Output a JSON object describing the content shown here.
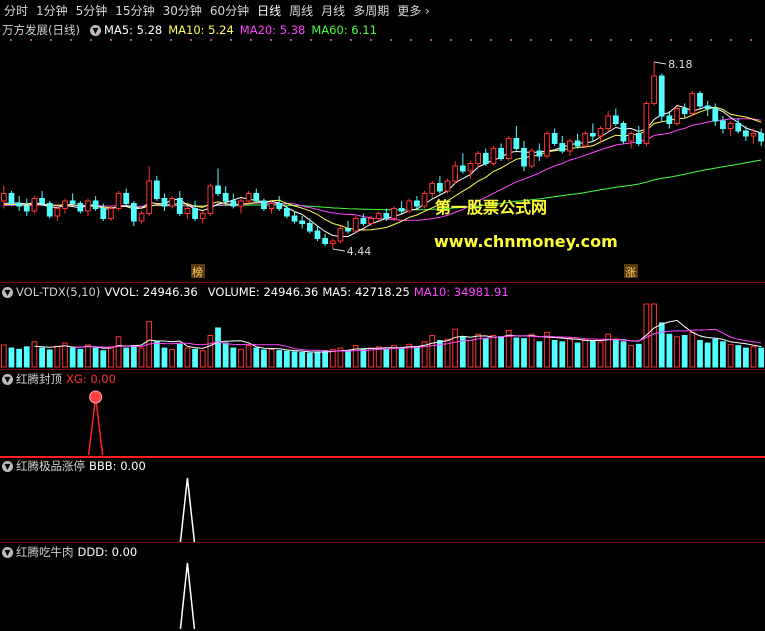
{
  "toolbar": {
    "tabs": [
      "分时",
      "1分钟",
      "5分钟",
      "15分钟",
      "30分钟",
      "60分钟",
      "日线",
      "周线",
      "月线",
      "多周期"
    ],
    "more": "更多",
    "active": "日线"
  },
  "main_panel": {
    "title": "万方发展(日线)",
    "ma": [
      {
        "label": "MA5: 5.28",
        "color": "#ffffff"
      },
      {
        "label": "MA10: 5.24",
        "color": "#ffff55"
      },
      {
        "label": "MA20: 5.38",
        "color": "#ff44ff"
      },
      {
        "label": "MA60: 6.11",
        "color": "#44ff44"
      }
    ],
    "high_label": "8.18",
    "low_label": "4.44",
    "watermark_title": "第一股票公式网",
    "watermark_url": "www.chnmoney.com",
    "tag_left": "榜",
    "tag_right": "涨"
  },
  "vol_panel": {
    "title": "VOL-TDX(5,10)",
    "vvol": "VVOL: 24946.36",
    "volume": "VOLUME: 24946.36",
    "ma5": "MA5: 42718.25",
    "ma10": "MA10: 34981.91"
  },
  "ind1": {
    "name": "红腾封顶",
    "value": "XG: 0.00"
  },
  "ind2": {
    "name": "红腾极品涨停",
    "value": "BBB: 0.00"
  },
  "ind3": {
    "name": "红腾吃牛肉",
    "value": "DDD: 0.00"
  },
  "colors": {
    "up": "#ff3232",
    "down": "#54ffff",
    "ma5": "#ffffff",
    "ma10": "#ffff55",
    "ma20": "#ff44ff",
    "ma60": "#44ff44",
    "sep": "#7a0e0e"
  },
  "chart_data": {
    "type": "candlestick",
    "ylim": [
      4.2,
      8.5
    ],
    "days": 100,
    "ohlc": [
      [
        5.4,
        5.7,
        5.25,
        5.55
      ],
      [
        5.55,
        5.6,
        5.3,
        5.35
      ],
      [
        5.35,
        5.5,
        5.2,
        5.3
      ],
      [
        5.3,
        5.45,
        5.1,
        5.2
      ],
      [
        5.2,
        5.5,
        5.15,
        5.45
      ],
      [
        5.45,
        5.6,
        5.3,
        5.35
      ],
      [
        5.35,
        5.4,
        5.05,
        5.1
      ],
      [
        5.1,
        5.3,
        5.0,
        5.25
      ],
      [
        5.25,
        5.45,
        5.15,
        5.4
      ],
      [
        5.4,
        5.55,
        5.3,
        5.35
      ],
      [
        5.35,
        5.4,
        5.15,
        5.2
      ],
      [
        5.2,
        5.45,
        5.1,
        5.4
      ],
      [
        5.4,
        5.5,
        5.2,
        5.25
      ],
      [
        5.25,
        5.35,
        5.0,
        5.05
      ],
      [
        5.05,
        5.3,
        5.0,
        5.25
      ],
      [
        5.25,
        5.6,
        5.2,
        5.55
      ],
      [
        5.55,
        5.65,
        5.3,
        5.35
      ],
      [
        5.35,
        5.4,
        4.9,
        5.0
      ],
      [
        5.0,
        5.2,
        4.95,
        5.15
      ],
      [
        5.15,
        6.1,
        5.1,
        5.8
      ],
      [
        5.8,
        5.9,
        5.4,
        5.45
      ],
      [
        5.45,
        5.55,
        5.2,
        5.3
      ],
      [
        5.3,
        5.5,
        5.25,
        5.45
      ],
      [
        5.45,
        5.6,
        5.1,
        5.15
      ],
      [
        5.15,
        5.3,
        5.05,
        5.25
      ],
      [
        5.25,
        5.4,
        5.0,
        5.05
      ],
      [
        5.05,
        5.2,
        4.95,
        5.15
      ],
      [
        5.15,
        5.75,
        5.1,
        5.7
      ],
      [
        5.7,
        6.05,
        5.5,
        5.55
      ],
      [
        5.55,
        5.7,
        5.3,
        5.4
      ],
      [
        5.4,
        5.55,
        5.25,
        5.3
      ],
      [
        5.3,
        5.45,
        5.15,
        5.4
      ],
      [
        5.4,
        5.6,
        5.35,
        5.55
      ],
      [
        5.55,
        5.65,
        5.35,
        5.4
      ],
      [
        5.4,
        5.45,
        5.2,
        5.25
      ],
      [
        5.25,
        5.4,
        5.15,
        5.35
      ],
      [
        5.35,
        5.5,
        5.2,
        5.25
      ],
      [
        5.25,
        5.3,
        5.05,
        5.1
      ],
      [
        5.1,
        5.2,
        4.95,
        5.0
      ],
      [
        5.0,
        5.1,
        4.85,
        4.95
      ],
      [
        4.95,
        5.05,
        4.75,
        4.8
      ],
      [
        4.8,
        4.9,
        4.6,
        4.65
      ],
      [
        4.65,
        4.75,
        4.5,
        4.55
      ],
      [
        4.55,
        4.65,
        4.44,
        4.6
      ],
      [
        4.6,
        4.9,
        4.55,
        4.85
      ],
      [
        4.85,
        5.0,
        4.75,
        4.8
      ],
      [
        4.8,
        5.1,
        4.75,
        5.05
      ],
      [
        5.05,
        5.15,
        4.9,
        4.95
      ],
      [
        4.95,
        5.1,
        4.9,
        5.05
      ],
      [
        5.05,
        5.2,
        5.0,
        5.15
      ],
      [
        5.15,
        5.25,
        5.0,
        5.05
      ],
      [
        5.05,
        5.3,
        5.0,
        5.25
      ],
      [
        5.25,
        5.4,
        5.15,
        5.2
      ],
      [
        5.2,
        5.45,
        5.15,
        5.4
      ],
      [
        5.4,
        5.5,
        5.25,
        5.3
      ],
      [
        5.3,
        5.6,
        5.25,
        5.55
      ],
      [
        5.55,
        5.8,
        5.45,
        5.75
      ],
      [
        5.75,
        5.9,
        5.55,
        5.6
      ],
      [
        5.6,
        5.85,
        5.55,
        5.8
      ],
      [
        5.8,
        6.2,
        5.75,
        6.1
      ],
      [
        6.1,
        6.35,
        5.95,
        6.0
      ],
      [
        6.0,
        6.2,
        5.85,
        6.15
      ],
      [
        6.15,
        6.4,
        6.05,
        6.35
      ],
      [
        6.35,
        6.45,
        6.1,
        6.15
      ],
      [
        6.15,
        6.5,
        6.1,
        6.45
      ],
      [
        6.45,
        6.55,
        6.2,
        6.25
      ],
      [
        6.25,
        6.7,
        6.2,
        6.65
      ],
      [
        6.65,
        6.9,
        6.4,
        6.45
      ],
      [
        6.45,
        6.6,
        6.0,
        6.1
      ],
      [
        6.1,
        6.45,
        6.05,
        6.4
      ],
      [
        6.4,
        6.55,
        6.2,
        6.3
      ],
      [
        6.3,
        6.8,
        6.25,
        6.75
      ],
      [
        6.75,
        6.85,
        6.5,
        6.55
      ],
      [
        6.55,
        6.7,
        6.35,
        6.4
      ],
      [
        6.4,
        6.65,
        6.3,
        6.6
      ],
      [
        6.6,
        6.75,
        6.45,
        6.5
      ],
      [
        6.5,
        6.8,
        6.45,
        6.75
      ],
      [
        6.75,
        6.95,
        6.6,
        6.7
      ],
      [
        6.7,
        6.9,
        6.55,
        6.85
      ],
      [
        6.85,
        7.2,
        6.8,
        7.1
      ],
      [
        7.1,
        7.25,
        6.9,
        6.95
      ],
      [
        6.95,
        7.0,
        6.55,
        6.6
      ],
      [
        6.6,
        6.8,
        6.45,
        6.75
      ],
      [
        6.75,
        6.9,
        6.5,
        6.55
      ],
      [
        6.55,
        7.4,
        6.5,
        7.35
      ],
      [
        7.35,
        8.18,
        7.3,
        7.9
      ],
      [
        7.9,
        7.95,
        7.0,
        7.1
      ],
      [
        7.1,
        7.2,
        6.85,
        6.95
      ],
      [
        6.95,
        7.3,
        6.9,
        7.25
      ],
      [
        7.25,
        7.35,
        7.05,
        7.15
      ],
      [
        7.15,
        7.6,
        7.1,
        7.55
      ],
      [
        7.55,
        7.6,
        7.25,
        7.3
      ],
      [
        7.3,
        7.4,
        7.1,
        7.25
      ],
      [
        7.25,
        7.35,
        6.9,
        7.0
      ],
      [
        7.0,
        7.1,
        6.75,
        6.85
      ],
      [
        6.85,
        7.0,
        6.7,
        6.95
      ],
      [
        6.95,
        7.05,
        6.75,
        6.8
      ],
      [
        6.8,
        6.9,
        6.6,
        6.7
      ],
      [
        6.7,
        6.85,
        6.55,
        6.75
      ],
      [
        6.75,
        6.85,
        6.5,
        6.6
      ]
    ],
    "volume": [
      0.35,
      0.3,
      0.28,
      0.32,
      0.4,
      0.3,
      0.27,
      0.33,
      0.38,
      0.3,
      0.28,
      0.35,
      0.3,
      0.26,
      0.32,
      0.48,
      0.3,
      0.34,
      0.3,
      0.72,
      0.4,
      0.3,
      0.28,
      0.36,
      0.3,
      0.28,
      0.26,
      0.5,
      0.62,
      0.38,
      0.3,
      0.28,
      0.34,
      0.3,
      0.27,
      0.28,
      0.26,
      0.25,
      0.24,
      0.23,
      0.22,
      0.24,
      0.26,
      0.28,
      0.3,
      0.25,
      0.34,
      0.28,
      0.3,
      0.32,
      0.28,
      0.34,
      0.3,
      0.36,
      0.32,
      0.4,
      0.5,
      0.42,
      0.44,
      0.6,
      0.48,
      0.42,
      0.52,
      0.45,
      0.5,
      0.48,
      0.58,
      0.46,
      0.45,
      0.52,
      0.4,
      0.55,
      0.42,
      0.4,
      0.46,
      0.38,
      0.44,
      0.42,
      0.4,
      0.52,
      0.42,
      0.4,
      0.34,
      0.36,
      1.0,
      1.0,
      0.7,
      0.52,
      0.48,
      0.5,
      0.55,
      0.42,
      0.38,
      0.44,
      0.4,
      0.36,
      0.34,
      0.3,
      0.32,
      0.3
    ],
    "xg_peak_day": 12,
    "bbb_peak_day": 24,
    "ddd_peak_day": 24
  }
}
